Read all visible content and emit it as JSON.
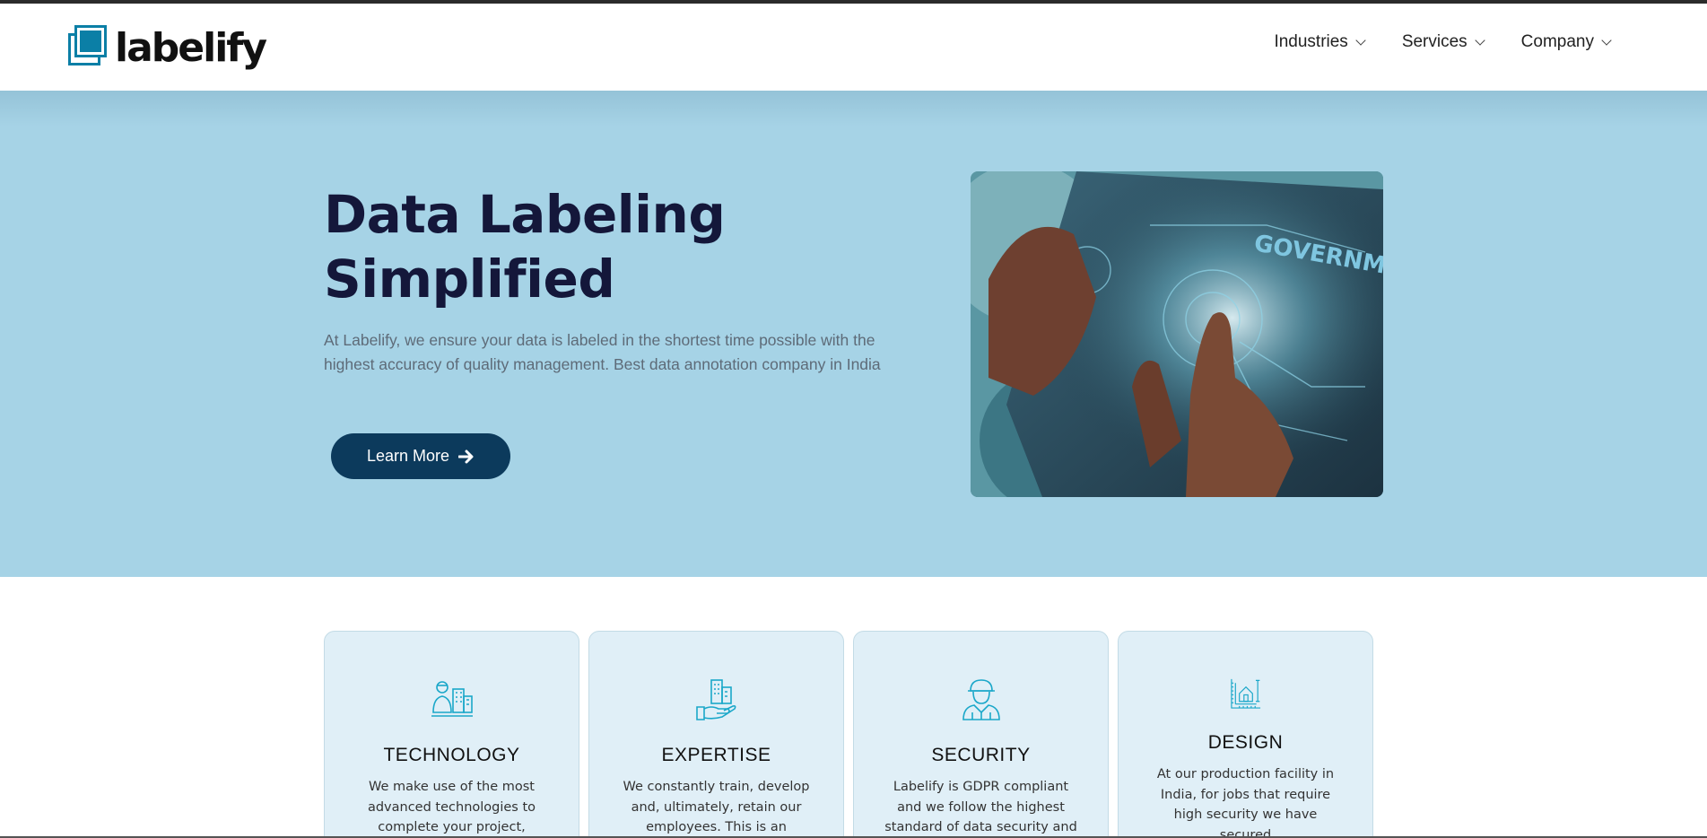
{
  "brand": {
    "name": "labelify",
    "accent": "#0b7fa6"
  },
  "nav": {
    "items": [
      {
        "label": "Industries"
      },
      {
        "label": "Services"
      },
      {
        "label": "Company"
      }
    ]
  },
  "hero": {
    "title_line1": "Data Labeling",
    "title_line2": "Simplified",
    "text": "At Labelify, we ensure your data is labeled in the shortest time possible with the highest accuracy of quality management. Best data annotation company in India",
    "button_label": "Learn More",
    "image_text": "GOVERNMENT",
    "bg_color": "#a6d3e6",
    "button_color": "#0c3a5c"
  },
  "features": [
    {
      "icon": "worker-building-icon",
      "title": "TECHNOLOGY",
      "text": "We make use of the most advanced technologies to complete your project,"
    },
    {
      "icon": "hand-building-icon",
      "title": "EXPERTISE",
      "text": "We constantly train, develop and, ultimately, retain our employees. This is an"
    },
    {
      "icon": "engineer-icon",
      "title": "SECURITY",
      "text": "Labelify is GDPR compliant and we follow the highest standard of data security and"
    },
    {
      "icon": "blueprint-house-icon",
      "title": "DESIGN",
      "text": "At our production facility in India, for jobs that require high security we have secured"
    }
  ]
}
